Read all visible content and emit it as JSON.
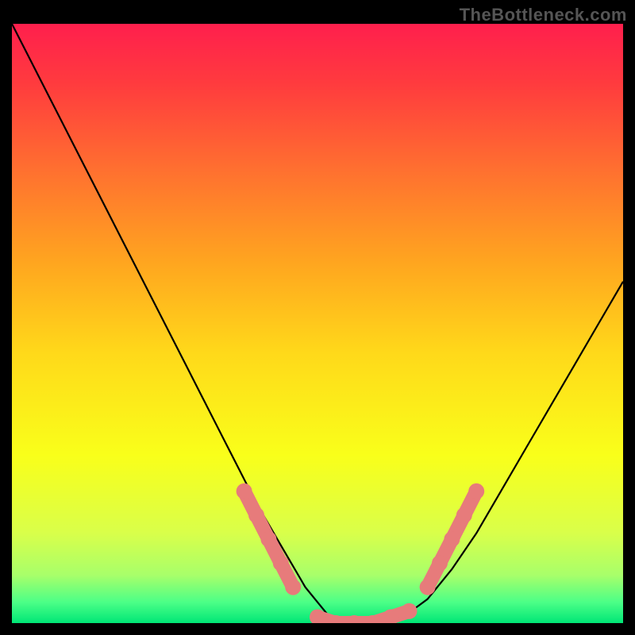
{
  "watermark": "TheBottleneck.com",
  "colors": {
    "bg": "#000000",
    "curve": "#000000",
    "marker": "#e77b7b",
    "gradient_stops": [
      {
        "offset": 0.0,
        "color": "#ff1f4d"
      },
      {
        "offset": 0.1,
        "color": "#ff3b3e"
      },
      {
        "offset": 0.25,
        "color": "#ff722f"
      },
      {
        "offset": 0.4,
        "color": "#ffa61f"
      },
      {
        "offset": 0.55,
        "color": "#ffd91a"
      },
      {
        "offset": 0.72,
        "color": "#f9ff1a"
      },
      {
        "offset": 0.85,
        "color": "#d9ff4a"
      },
      {
        "offset": 0.92,
        "color": "#a8ff6a"
      },
      {
        "offset": 0.965,
        "color": "#4cff87"
      },
      {
        "offset": 1.0,
        "color": "#00e676"
      }
    ]
  },
  "chart_data": {
    "type": "line",
    "x_range": [
      0,
      100
    ],
    "y_range": [
      0,
      100
    ],
    "series": [
      {
        "name": "bottleneck-curve",
        "x": [
          0,
          4,
          8,
          12,
          16,
          20,
          24,
          28,
          32,
          36,
          40,
          44,
          48,
          52,
          56,
          60,
          64,
          68,
          72,
          76,
          80,
          84,
          88,
          92,
          96,
          100
        ],
        "y": [
          100,
          92,
          84,
          76,
          68,
          60,
          52,
          44,
          36,
          28,
          20,
          13,
          6,
          1,
          0,
          0,
          1,
          4,
          9,
          15,
          22,
          29,
          36,
          43,
          50,
          57
        ]
      }
    ],
    "markers_left": {
      "x": [
        38,
        40,
        42,
        44,
        46
      ],
      "y": [
        22,
        18,
        14,
        10,
        6
      ]
    },
    "markers_floor": {
      "x": [
        50,
        53,
        56,
        59,
        62,
        65
      ],
      "y": [
        1,
        0,
        0,
        0,
        1,
        2
      ]
    },
    "markers_right": {
      "x": [
        68,
        70,
        72,
        74,
        76
      ],
      "y": [
        6,
        10,
        14,
        18,
        22
      ]
    }
  }
}
